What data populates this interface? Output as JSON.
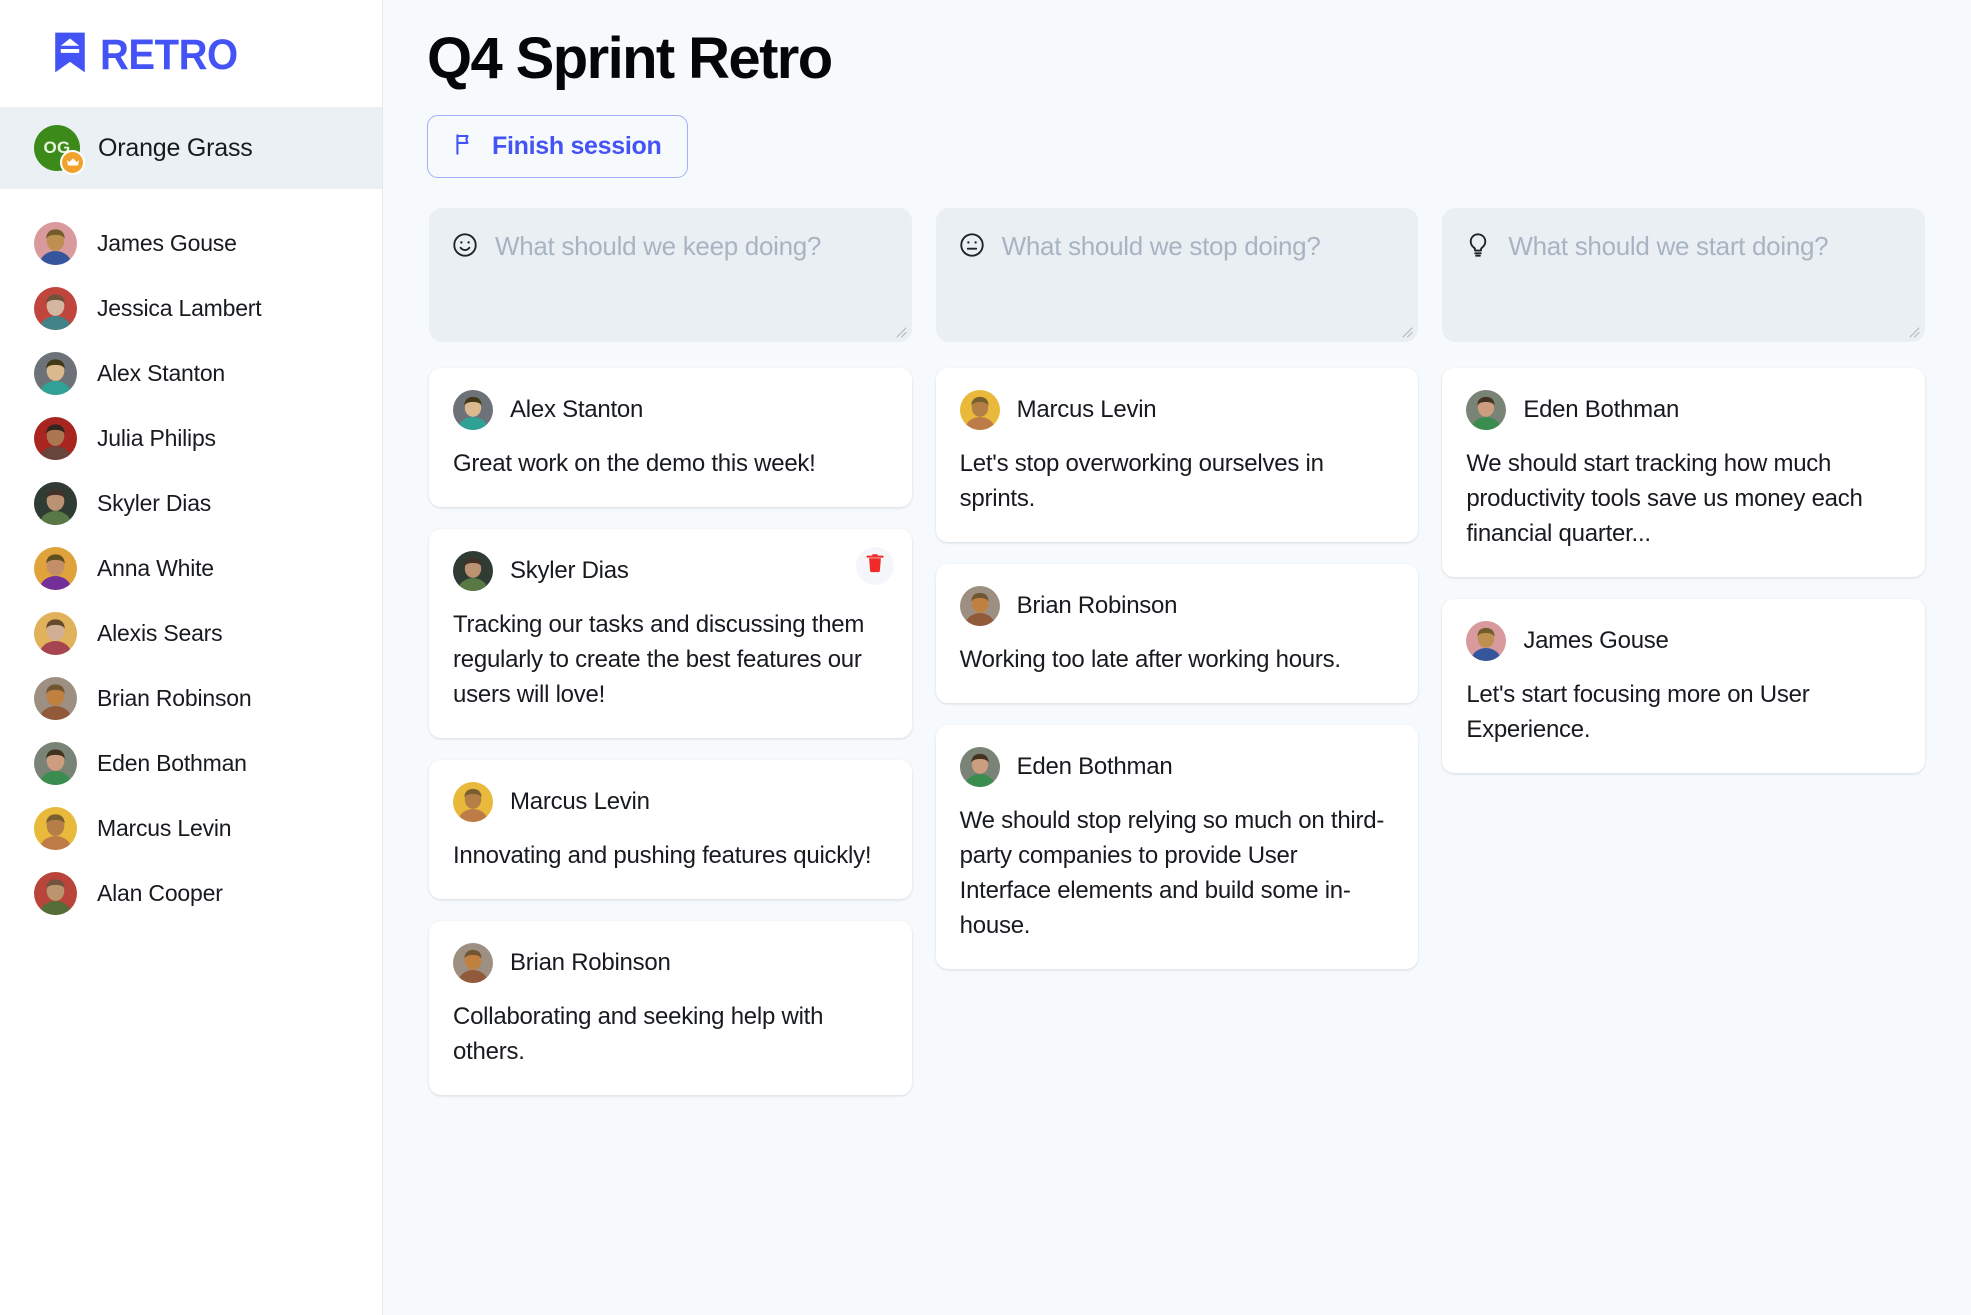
{
  "app": {
    "logo_text": "RETRO",
    "accent_color": "#4353f5",
    "background_color": "#f7fafc"
  },
  "sidebar": {
    "owner": {
      "initials": "OG",
      "name": "Orange Grass",
      "badge": "crown-icon",
      "avatar_color": "#3c8a19",
      "badge_color": "#f0a22a"
    },
    "members": [
      {
        "name": "James Gouse",
        "avatar_color": "#d99a9e"
      },
      {
        "name": "Jessica Lambert",
        "avatar_color": "#c0453c"
      },
      {
        "name": "Alex Stanton",
        "avatar_color": "#6d7278"
      },
      {
        "name": "Julia Philips",
        "avatar_color": "#a8261f"
      },
      {
        "name": "Skyler Dias",
        "avatar_color": "#2f3b33"
      },
      {
        "name": "Anna White",
        "avatar_color": "#e0a33c"
      },
      {
        "name": "Alexis Sears",
        "avatar_color": "#e0b25c"
      },
      {
        "name": "Brian Robinson",
        "avatar_color": "#9d8f82"
      },
      {
        "name": "Eden Bothman",
        "avatar_color": "#7a8476"
      },
      {
        "name": "Marcus Levin",
        "avatar_color": "#e8b93a"
      },
      {
        "name": "Alan Cooper",
        "avatar_color": "#b8443a"
      }
    ]
  },
  "header": {
    "title": "Q4 Sprint Retro",
    "finish_button": {
      "label": "Finish session",
      "icon": "flag-icon"
    }
  },
  "board": {
    "columns": [
      {
        "id": "keep",
        "icon": "smiley-happy-icon",
        "placeholder": "What should we keep doing?",
        "cards": [
          {
            "author": "Alex Stanton",
            "avatar_color": "#6d7278",
            "text": "Great work on the demo this week!",
            "deletable": false
          },
          {
            "author": "Skyler Dias",
            "avatar_color": "#2f3b33",
            "text": "Tracking our tasks and discussing them regularly to create the best features our users will love!",
            "deletable": true,
            "delete_icon": "trash-icon"
          },
          {
            "author": "Marcus Levin",
            "avatar_color": "#e8b93a",
            "text": "Innovating and pushing features quickly!",
            "deletable": false
          },
          {
            "author": "Brian Robinson",
            "avatar_color": "#9d8f82",
            "text": "Collaborating and seeking help with others.",
            "deletable": false
          }
        ]
      },
      {
        "id": "stop",
        "icon": "smiley-neutral-icon",
        "placeholder": "What should we stop doing?",
        "cards": [
          {
            "author": "Marcus Levin",
            "avatar_color": "#e8b93a",
            "text": "Let's stop overworking ourselves in sprints.",
            "deletable": false
          },
          {
            "author": "Brian Robinson",
            "avatar_color": "#9d8f82",
            "text": "Working too late after working hours.",
            "deletable": false
          },
          {
            "author": "Eden Bothman",
            "avatar_color": "#7a8476",
            "text": "We should stop relying so much on third-party companies to provide User Interface elements and build some in-house.",
            "deletable": false
          }
        ]
      },
      {
        "id": "start",
        "icon": "lightbulb-icon",
        "placeholder": "What should we start doing?",
        "cards": [
          {
            "author": "Eden Bothman",
            "avatar_color": "#7a8476",
            "text": "We should start tracking how much productivity tools save us money each financial quarter...",
            "deletable": false
          },
          {
            "author": "James Gouse",
            "avatar_color": "#d99a9e",
            "text": "Let's start focusing more on User Experience.",
            "deletable": false
          }
        ]
      }
    ]
  }
}
